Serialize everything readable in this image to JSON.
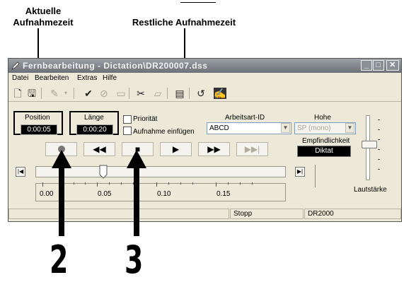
{
  "callouts": {
    "left_line1": "Aktuelle",
    "left_line2": "Aufnahmezeit",
    "right": "Restliche Aufnahmezeit"
  },
  "window": {
    "title": "Fernbearbeitung - Dictation\\DR200007.dss",
    "menu": [
      "Datei",
      "Bearbeiten",
      "Extras",
      "Hilfe"
    ]
  },
  "panel": {
    "position_label": "Position",
    "position_value": "0:00:05",
    "laenge_label": "Länge",
    "laenge_value": "0:00:20",
    "prioritaet": "Priorität",
    "aufnahme_einfuegen": "Aufnahme einfügen",
    "arbeitsart_label": "Arbeitsart-ID",
    "arbeitsart_value": "ABCD",
    "hohe_label": "Hohe",
    "hohe_value": "SP (mono)",
    "empfindlichkeit_label": "Empfindlichkeit",
    "empfindlichkeit_value": "Diktat",
    "lautstaerke_label": "Lautstärke"
  },
  "timeline": {
    "ticks": [
      "0.00",
      "0.05",
      "0.10",
      "0.15"
    ],
    "position_fraction": 0.27
  },
  "status": {
    "state": "Stopp",
    "device": "DR2000"
  },
  "markers": {
    "left": "2",
    "right": "3"
  }
}
